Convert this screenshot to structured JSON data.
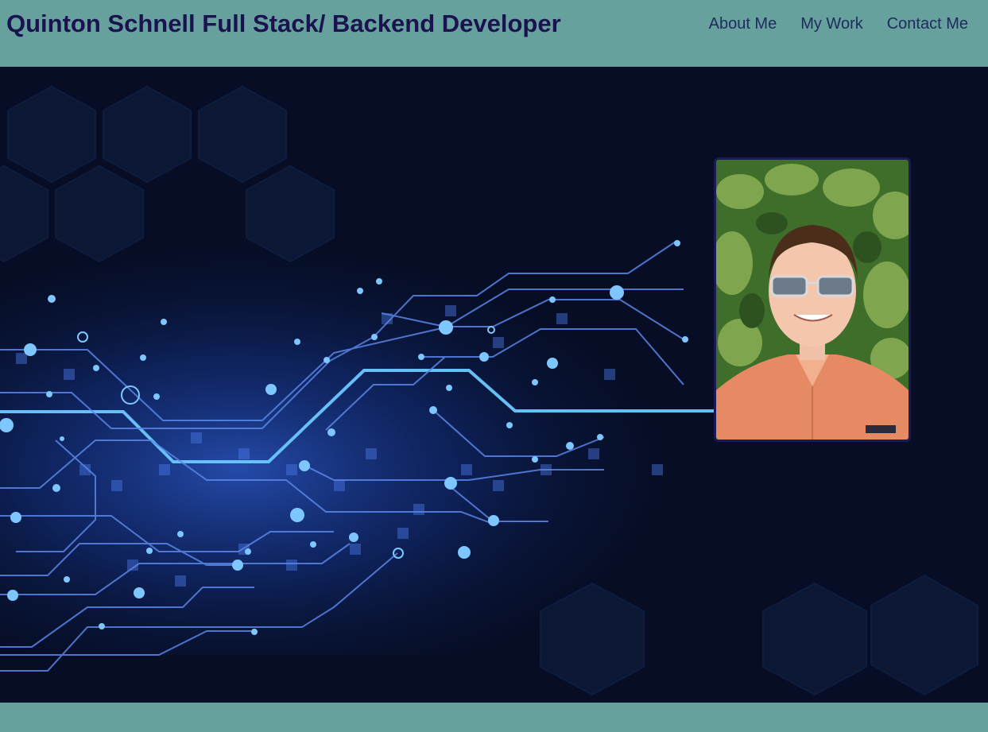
{
  "header": {
    "title": "Quinton Schnell Full Stack/ Backend Developer",
    "nav": [
      {
        "label": "About Me"
      },
      {
        "label": "My Work"
      },
      {
        "label": "Contact Me"
      }
    ]
  },
  "hero": {
    "background": "circuit-board-image",
    "profile_photo": "profile-photo"
  },
  "colors": {
    "header_bg": "#66a19d",
    "title": "#1a1350",
    "nav_link": "#1f2a5e",
    "hero_bg": "#060d24",
    "photo_frame": "#1c1a55"
  }
}
